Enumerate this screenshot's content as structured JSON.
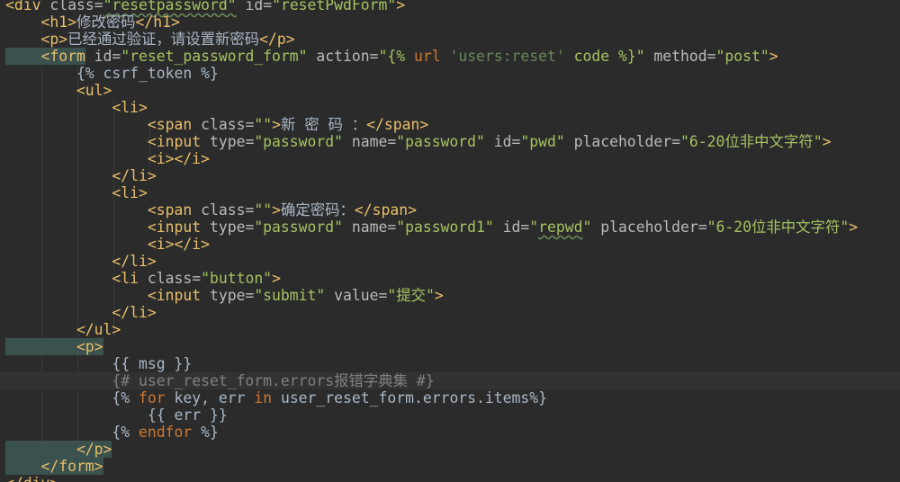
{
  "editor": {
    "lines": [
      [
        {
          "c": "t",
          "v": "<div "
        },
        {
          "c": "a",
          "v": "class="
        },
        {
          "c": "s sq",
          "v": "\"resetpassword\""
        },
        {
          "c": "a",
          "v": " id="
        },
        {
          "c": "s",
          "v": "\"resetPwdForm\""
        },
        {
          "c": "t",
          "v": ">"
        }
      ],
      [
        {
          "c": "t",
          "v": "    <h1>"
        },
        {
          "c": "p",
          "v": "修改密码"
        },
        {
          "c": "t",
          "v": "</h1>"
        }
      ],
      [
        {
          "c": "t",
          "v": "    <p>"
        },
        {
          "c": "p",
          "v": "已经通过验证，请设置新密码"
        },
        {
          "c": "t",
          "v": "</p>"
        }
      ],
      [
        {
          "c": "t hl",
          "v": "    <form"
        },
        {
          "c": "a",
          "v": " id="
        },
        {
          "c": "s",
          "v": "\"reset_password_form\""
        },
        {
          "c": "a",
          "v": " action="
        },
        {
          "c": "s",
          "v": "\"{% "
        },
        {
          "c": "kw",
          "v": "url "
        },
        {
          "c": "ps",
          "v": "'users:reset'"
        },
        {
          "c": "s",
          "v": " code %}\""
        },
        {
          "c": "a",
          "v": " method="
        },
        {
          "c": "s",
          "v": "\"post\""
        },
        {
          "c": "t",
          "v": ">"
        }
      ],
      [
        {
          "c": "p",
          "v": "        {% csrf_token %}"
        }
      ],
      [
        {
          "c": "t",
          "v": "        <ul>"
        }
      ],
      [
        {
          "c": "t",
          "v": "            <li>"
        }
      ],
      [
        {
          "c": "t",
          "v": "                <span "
        },
        {
          "c": "a",
          "v": "class="
        },
        {
          "c": "s",
          "v": "\"\""
        },
        {
          "c": "t",
          "v": ">"
        },
        {
          "c": "p",
          "v": "新 密 码 ："
        },
        {
          "c": "t",
          "v": "</span>"
        }
      ],
      [
        {
          "c": "t",
          "v": "                <input "
        },
        {
          "c": "a",
          "v": "type="
        },
        {
          "c": "s",
          "v": "\"password\""
        },
        {
          "c": "a",
          "v": " name="
        },
        {
          "c": "s",
          "v": "\"password\""
        },
        {
          "c": "a",
          "v": " id="
        },
        {
          "c": "s",
          "v": "\"pwd\""
        },
        {
          "c": "a",
          "v": " placeholder="
        },
        {
          "c": "s",
          "v": "\"6-20位非中文字符\""
        },
        {
          "c": "t",
          "v": ">"
        }
      ],
      [
        {
          "c": "t",
          "v": "                <i></i>"
        }
      ],
      [
        {
          "c": "t",
          "v": "            </li>"
        }
      ],
      [
        {
          "c": "t",
          "v": "            <li>"
        }
      ],
      [
        {
          "c": "t",
          "v": "                <span "
        },
        {
          "c": "a",
          "v": "class="
        },
        {
          "c": "s",
          "v": "\"\""
        },
        {
          "c": "t",
          "v": ">"
        },
        {
          "c": "p",
          "v": "确定密码："
        },
        {
          "c": "t",
          "v": "</span>"
        }
      ],
      [
        {
          "c": "t",
          "v": "                <input "
        },
        {
          "c": "a",
          "v": "type="
        },
        {
          "c": "s",
          "v": "\"password\""
        },
        {
          "c": "a",
          "v": " name="
        },
        {
          "c": "s",
          "v": "\"password1\""
        },
        {
          "c": "a",
          "v": " id="
        },
        {
          "c": "s",
          "v": "\""
        },
        {
          "c": "s sq",
          "v": "repwd"
        },
        {
          "c": "s",
          "v": "\""
        },
        {
          "c": "a",
          "v": " placeholder="
        },
        {
          "c": "s",
          "v": "\"6-20位非中文字符\""
        },
        {
          "c": "t",
          "v": ">"
        }
      ],
      [
        {
          "c": "t",
          "v": "                <i></i>"
        }
      ],
      [
        {
          "c": "t",
          "v": "            </li>"
        }
      ],
      [
        {
          "c": "t",
          "v": "            <li "
        },
        {
          "c": "a",
          "v": "class="
        },
        {
          "c": "s",
          "v": "\"button\""
        },
        {
          "c": "t",
          "v": ">"
        }
      ],
      [
        {
          "c": "t",
          "v": "                <input "
        },
        {
          "c": "a",
          "v": "type="
        },
        {
          "c": "s",
          "v": "\"submit\""
        },
        {
          "c": "a",
          "v": " value="
        },
        {
          "c": "s",
          "v": "\"提交\""
        },
        {
          "c": "t",
          "v": ">"
        }
      ],
      [
        {
          "c": "t",
          "v": "            </li>"
        }
      ],
      [
        {
          "c": "t",
          "v": "        </ul>"
        }
      ],
      [
        {
          "c": "t hl",
          "v": "        <p>"
        }
      ],
      [
        {
          "c": "p",
          "v": "            {{ msg }}"
        }
      ],
      [
        {
          "c": "cm",
          "v": "            {# user_reset_form.errors报错字典集 #}"
        }
      ],
      [
        {
          "c": "p",
          "v": "            {% "
        },
        {
          "c": "kw",
          "v": "for"
        },
        {
          "c": "p",
          "v": " key, err "
        },
        {
          "c": "kw",
          "v": "in"
        },
        {
          "c": "p",
          "v": " user_reset_form.errors.items%}"
        }
      ],
      [
        {
          "c": "p",
          "v": "                {{ err }}"
        }
      ],
      [
        {
          "c": "p",
          "v": "            {% "
        },
        {
          "c": "kw",
          "v": "endfor"
        },
        {
          "c": "p",
          "v": " %}"
        }
      ],
      [
        {
          "c": "t hl",
          "v": "        </p>"
        }
      ],
      [
        {
          "c": "t hl",
          "v": "    </form>"
        }
      ],
      [
        {
          "c": "t",
          "v": "</div>"
        }
      ]
    ],
    "current_line": 22
  }
}
